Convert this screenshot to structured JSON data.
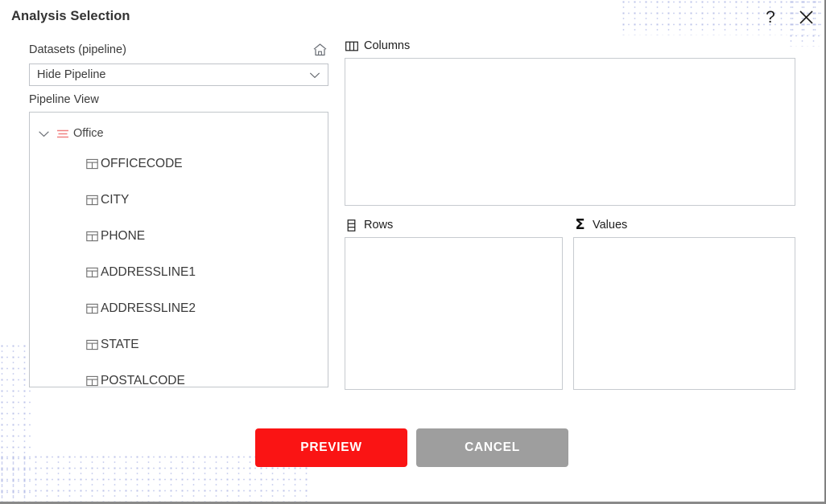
{
  "window": {
    "title": "Analysis Selection",
    "help_icon": "question-mark-icon",
    "close_icon": "close-x-icon"
  },
  "left_panel": {
    "datasets_label": "Datasets (pipeline)",
    "home_icon": "home-icon",
    "pipeline_select": {
      "value": "Hide Pipeline",
      "chevron_icon": "chevron-down-icon"
    },
    "pipeline_view_label": "Pipeline View",
    "tree": {
      "root": {
        "label": "Office",
        "expanded": true,
        "chevron_icon": "chevron-down-icon",
        "icon": "pipeline-lines-icon",
        "icon_color": "#f08080"
      },
      "children": [
        {
          "label": "OFFICECODE",
          "icon": "table-column-icon"
        },
        {
          "label": "CITY",
          "icon": "table-column-icon"
        },
        {
          "label": "PHONE",
          "icon": "table-column-icon"
        },
        {
          "label": "ADDRESSLINE1",
          "icon": "table-column-icon"
        },
        {
          "label": "ADDRESSLINE2",
          "icon": "table-column-icon"
        },
        {
          "label": "STATE",
          "icon": "table-column-icon"
        },
        {
          "label": "POSTALCODE",
          "icon": "table-column-icon"
        }
      ]
    }
  },
  "right_panel": {
    "columns": {
      "label": "Columns",
      "icon": "columns-icon",
      "items": []
    },
    "rows": {
      "label": "Rows",
      "icon": "rows-icon",
      "items": []
    },
    "values": {
      "label": "Values",
      "icon": "sigma-icon",
      "items": []
    }
  },
  "footer": {
    "preview_label": "PREVIEW",
    "cancel_label": "CANCEL"
  },
  "colors": {
    "preview_button": "#fa1414",
    "cancel_button": "#9e9e9e",
    "accent_red": "#f08080",
    "dot_pattern": "#b9c0e8",
    "border": "#c7cbd0"
  }
}
